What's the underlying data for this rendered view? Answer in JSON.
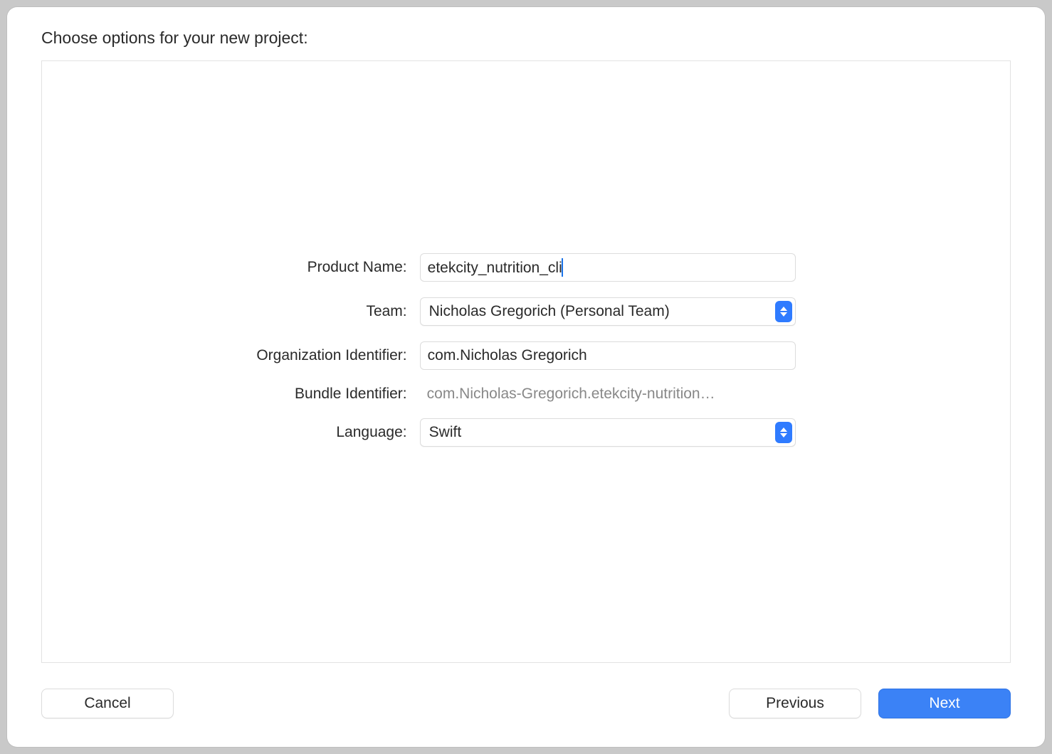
{
  "dialog": {
    "title": "Choose options for your new project:"
  },
  "form": {
    "productName": {
      "label": "Product Name:",
      "value": "etekcity_nutrition_cli"
    },
    "team": {
      "label": "Team:",
      "value": "Nicholas Gregorich (Personal Team)"
    },
    "orgIdentifier": {
      "label": "Organization Identifier:",
      "value": "com.Nicholas Gregorich"
    },
    "bundleIdentifier": {
      "label": "Bundle Identifier:",
      "value": "com.Nicholas-Gregorich.etekcity-nutrition…"
    },
    "language": {
      "label": "Language:",
      "value": "Swift"
    }
  },
  "buttons": {
    "cancel": "Cancel",
    "previous": "Previous",
    "next": "Next"
  }
}
